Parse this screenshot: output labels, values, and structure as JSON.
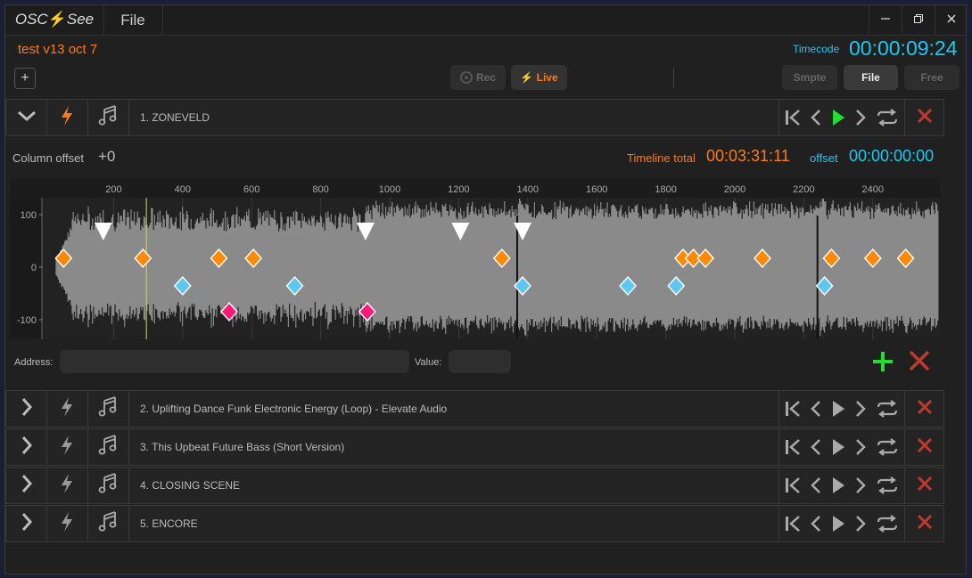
{
  "app": {
    "logo_text_left": "OSC",
    "logo_text_right": "See",
    "menu_file": "File"
  },
  "window_controls": {
    "minimize_icon": "minimize-icon",
    "restore_icon": "restore-icon",
    "close_icon": "close-icon"
  },
  "project": {
    "name": "test v13 oct 7"
  },
  "timecode": {
    "label": "Timecode",
    "value": "00:00:09:24"
  },
  "toolbar": {
    "add_icon": "plus-square-icon",
    "rec_label": "Rec",
    "live_label": "Live",
    "smpte_label": "Smpte",
    "file_label": "File",
    "free_label": "Free"
  },
  "tracks": [
    {
      "label": "1. ZONEVELD",
      "expanded": true,
      "active": true
    },
    {
      "label": "2. Uplifting Dance Funk Electronic Energy (Loop) - Elevate Audio",
      "expanded": false,
      "active": false
    },
    {
      "label": "3. This Upbeat Future Bass (Short Version)",
      "expanded": false,
      "active": false
    },
    {
      "label": "4. CLOSING SCENE",
      "expanded": false,
      "active": false
    },
    {
      "label": "5. ENCORE",
      "expanded": false,
      "active": false
    }
  ],
  "timeline": {
    "column_offset_label": "Column offset",
    "column_offset_value": "+0",
    "total_label": "Timeline total",
    "total_value": "00:03:31:11",
    "offset_label": "offset",
    "offset_value": "00:00:00:00",
    "x_ticks": [
      "200",
      "400",
      "600",
      "800",
      "1000",
      "1200",
      "1400",
      "1600",
      "1800",
      "2000",
      "2200",
      "2400"
    ],
    "y_ticks": [
      "100",
      "0",
      "-100"
    ],
    "playhead": 295,
    "cue_markers": {
      "white": [
        170,
        930,
        1205,
        1385
      ],
      "orange": [
        55,
        285,
        505,
        605,
        1325,
        1850,
        1880,
        1915,
        2080,
        2280,
        2400,
        2495
      ],
      "blue": [
        400,
        725,
        1385,
        1690,
        1830,
        2260
      ],
      "pink": [
        535,
        935
      ]
    },
    "colors": {
      "orange": "#ff8a00",
      "blue": "#5cc8f2",
      "pink": "#ff1a7a",
      "white": "#ffffff",
      "wave": "#8a8a8a"
    }
  },
  "address_row": {
    "address_label": "Address:",
    "address_value": "",
    "value_label": "Value:",
    "value_value": ""
  },
  "colors": {
    "accent_orange": "#ff7a1a",
    "accent_cyan": "#1ec8f0",
    "play_green": "#22dd33",
    "delete_red": "#c0392b"
  }
}
